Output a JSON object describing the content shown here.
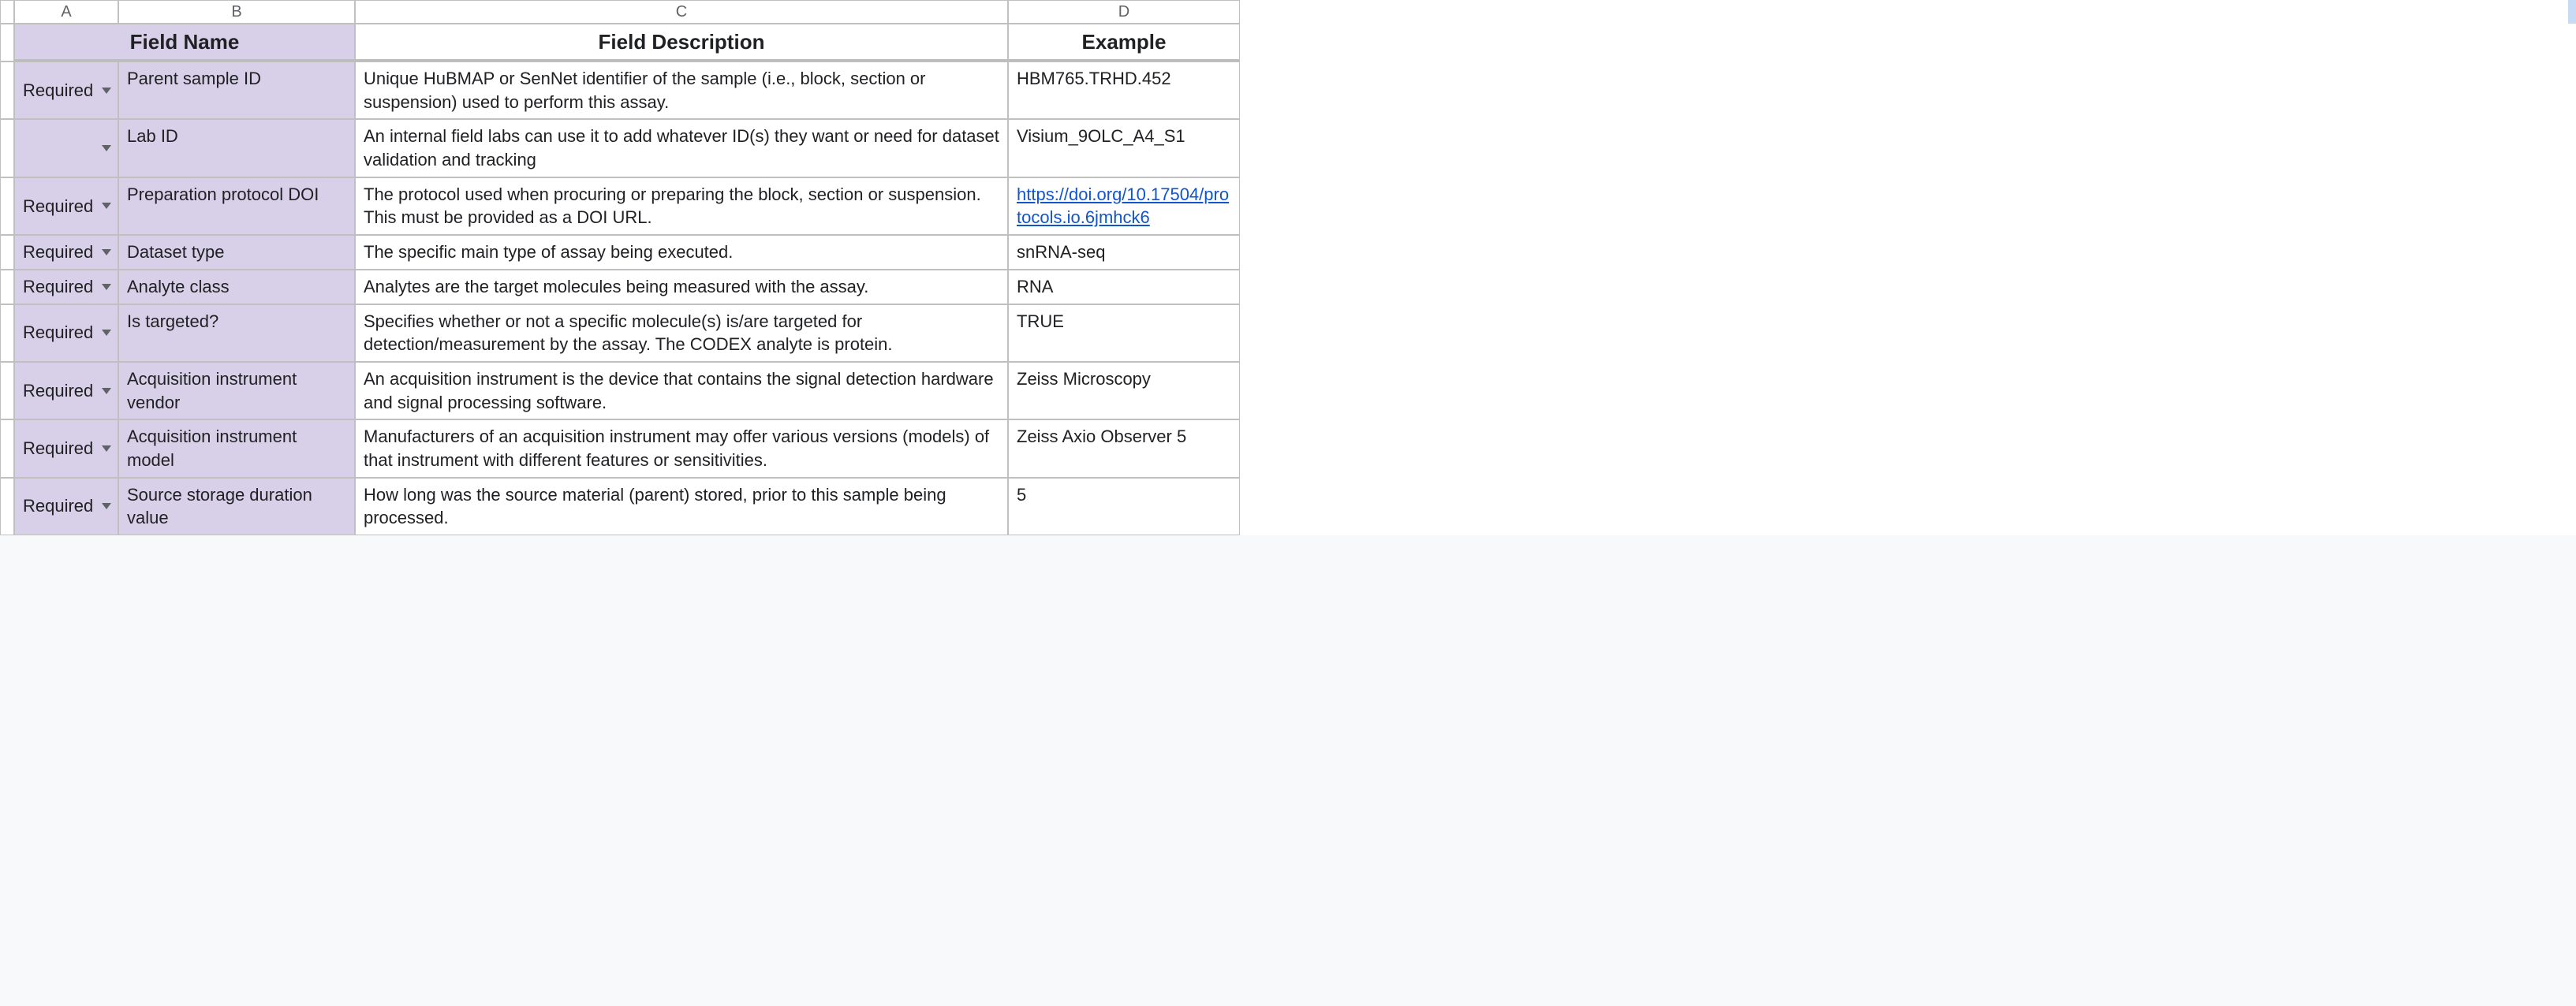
{
  "columns": {
    "A": "A",
    "B": "B",
    "C": "C",
    "D": "D"
  },
  "headers": {
    "field_name": "Field Name",
    "field_description": "Field Description",
    "example": "Example"
  },
  "rows": [
    {
      "required": "Required",
      "field_name": "Parent sample ID",
      "description": "Unique HuBMAP or SenNet identifier of the sample (i.e., block, section or suspension) used to perform this assay.",
      "example": "HBM765.TRHD.452",
      "example_is_link": false
    },
    {
      "required": "",
      "field_name": "Lab ID",
      "description": "An internal field labs can use it to add whatever ID(s) they want or need for dataset validation and tracking",
      "example": "Visium_9OLC_A4_S1",
      "example_is_link": false
    },
    {
      "required": "Required",
      "field_name": "Preparation protocol DOI",
      "description": "The protocol used when procuring or preparing the block, section or suspension. This must be provided as a DOI URL.",
      "example": "https://doi.org/10.17504/protocols.io.6jmhck6",
      "example_is_link": true
    },
    {
      "required": "Required",
      "field_name": "Dataset type",
      "description": "The specific main type of assay being executed.",
      "example": "snRNA-seq",
      "example_is_link": false
    },
    {
      "required": "Required",
      "field_name": "Analyte class",
      "description": "Analytes are the target molecules being measured with the assay.",
      "example": "RNA",
      "example_is_link": false
    },
    {
      "required": "Required",
      "field_name": "Is targeted?",
      "description": "Specifies whether or not a specific molecule(s) is/are targeted for detection/measurement by the assay. The CODEX analyte is protein.",
      "example": "TRUE",
      "example_is_link": false
    },
    {
      "required": "Required",
      "field_name": "Acquisition instrument vendor",
      "description": "An acquisition instrument is the device that contains the signal detection hardware and signal processing software.",
      "example": "Zeiss Microscopy",
      "example_is_link": false
    },
    {
      "required": "Required",
      "field_name": "Acquisition instrument model",
      "description": "Manufacturers of an acquisition instrument may offer various versions (models) of that instrument with different features or sensitivities.",
      "example": "Zeiss Axio Observer 5",
      "example_is_link": false
    },
    {
      "required": "Required",
      "field_name": "Source storage duration value",
      "description": "How long was the source material (parent) stored, prior to this sample being processed.",
      "example": "5",
      "example_is_link": false
    }
  ]
}
